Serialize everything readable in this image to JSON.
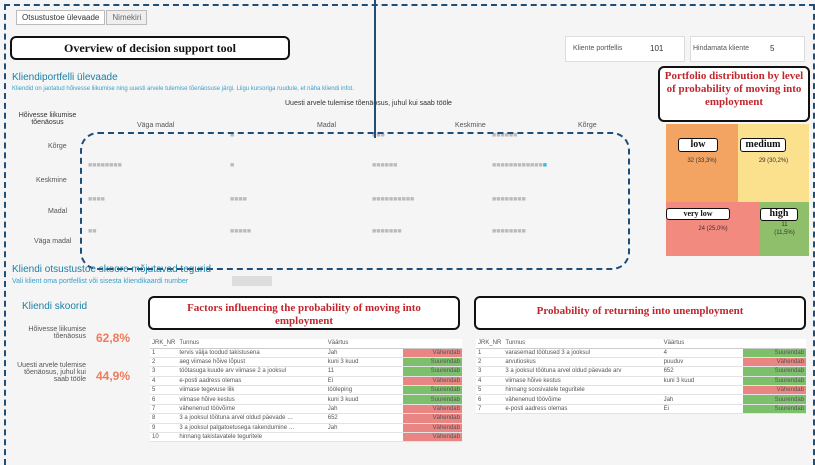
{
  "tabs": [
    "Otsustustoe ülevaade",
    "Nimekiri"
  ],
  "title_callout": "Overview of decision support tool",
  "stats": {
    "portfolio_label": "Kliente portfellis",
    "portfolio_value": "101",
    "unrated_label": "Hindamata kliente",
    "unrated_value": "5"
  },
  "portfolio": {
    "heading": "Kliendiportfelli ülevaade",
    "subtitle": "Kliendid on jaotatud hõivesse liikumise ning uuesti arvele tulemise tõenäosuse järgi. Liigu kursoriga ruudule, et näha kliendi infot.",
    "col_title": "Uuesti arvele tulemise tõenäosus, juhul kui saab tööle",
    "row_title": "Hõivesse liikumise tõenäosus",
    "columns": [
      "Väga madal",
      "Madal",
      "Keskmine",
      "Kõrge"
    ],
    "rows": [
      "Kõrge",
      "Keskmine",
      "Madal",
      "Väga madal"
    ]
  },
  "distribution_callout": "Portfolio distribution by level of probability of moving into employment",
  "treemap": {
    "low": {
      "label": "low",
      "value": "32 (33,3%)",
      "color": "#f4a462"
    },
    "medium": {
      "label": "medium",
      "value": "29 (30,2%)",
      "color": "#fbe08d"
    },
    "very_low": {
      "label": "very low",
      "value": "24 (25,0%)",
      "color": "#f28a80"
    },
    "high": {
      "label": "high",
      "value": "11",
      "value2": "(11,5%)",
      "color": "#8fbf6a"
    }
  },
  "factors_section": {
    "heading": "Kliendi otsustustoe skoore mõjutavad tegurid",
    "subtitle": "Vali klient oma portfellist või sisesta kliendikaardi number"
  },
  "scores": {
    "heading": "Kliendi skoorid",
    "employment_label": "Hõivesse liikumise tõenäosus",
    "employment_value": "62,8%",
    "return_label": "Uuesti arvele tulemise tõenäosus, juhul kui saab tööle",
    "return_value": "44,9%"
  },
  "employment_callout": "Factors influencing the probability of moving into employment",
  "unemployment_callout": "Probability of returning into unemployment",
  "table_headers": [
    "JRK_NR",
    "Tunnus",
    "Väärtus",
    ""
  ],
  "employment_factors": [
    [
      "1",
      "tervis välja toodud takistusena",
      "Jah",
      "Vähendab"
    ],
    [
      "2",
      "aeg viimase hõive lõpust",
      "kuni 3 kuud",
      "Suurendab"
    ],
    [
      "3",
      "töötasuga kuude arv viimase 2 a jooksul",
      "11",
      "Suurendab"
    ],
    [
      "4",
      "e-posti aadress olemas",
      "Ei",
      "Vähendab"
    ],
    [
      "5",
      "viimase tegevuse liik",
      "tööleping",
      "Suurendab"
    ],
    [
      "6",
      "viimase hõive kestus",
      "kuni 3 kuud",
      "Suurendab"
    ],
    [
      "7",
      "vähenenud töövõime",
      "Jah",
      "Vähendab"
    ],
    [
      "8",
      "3 a jooksul töötuna arvel oldud päevade …",
      "652",
      "Vähendab"
    ],
    [
      "9",
      "3 a jooksul palgatoetusega rakendumine …",
      "Jah",
      "Vähendab"
    ],
    [
      "10",
      "hinnang takistavatele teguritele",
      "",
      "Vähendab"
    ]
  ],
  "unemployment_factors": [
    [
      "1",
      "varasemad töötused 3 a jooksul",
      "4",
      "Suurendab"
    ],
    [
      "2",
      "arvutioskus",
      "puuduv",
      "Vähendab"
    ],
    [
      "3",
      "3 a jooksul töötuna arvel oldud päevade arv",
      "652",
      "Suurendab"
    ],
    [
      "4",
      "viimase hõive kestus",
      "kuni 3 kuud",
      "Suurendab"
    ],
    [
      "5",
      "hinnang soosivatele teguritele",
      "",
      "Vähendab"
    ],
    [
      "6",
      "vähenenud töövõime",
      "Jah",
      "Suurendab"
    ],
    [
      "7",
      "e-posti aadress olemas",
      "Ei",
      "Suurendab"
    ]
  ],
  "effect_colors": {
    "Vähendab": "#e98582",
    "Suurendab": "#7dc06b"
  }
}
